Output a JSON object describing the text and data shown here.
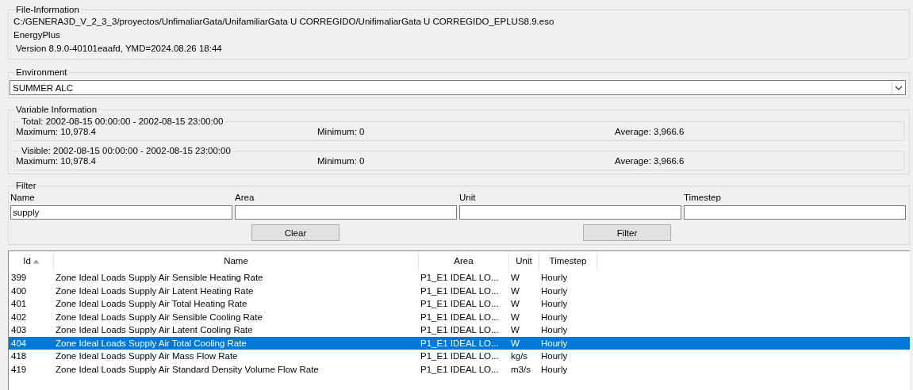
{
  "file_information": {
    "title": "File-Information",
    "path": "C:/GENERA3D_V_2_3_3/proyectos/UnfimaliarGata/UnifamiliarGata U CORREGIDO/UnifimaliarGata U CORREGIDO_EPLUS8.9.eso",
    "program": "EnergyPlus",
    "version": "Version 8.9.0-40101eaafd, YMD=2024.08.26 18:44"
  },
  "environment": {
    "title": "Environment",
    "value": "SUMMER ALC"
  },
  "variable_information": {
    "title": "Variable Information",
    "ranges": [
      {
        "title": "Total: 2002-08-15 00:00:00 - 2002-08-15 23:00:00",
        "maximum": "Maximum: 10,978.4",
        "minimum": "Minimum: 0",
        "average": "Average: 3,966.6"
      },
      {
        "title": "Visible: 2002-08-15 00:00:00 - 2002-08-15 23:00:00",
        "maximum": "Maximum: 10,978.4",
        "minimum": "Minimum: 0",
        "average": "Average: 3,966.6"
      }
    ]
  },
  "filter": {
    "title": "Filter",
    "fields": [
      {
        "label": "Name",
        "value": "supply"
      },
      {
        "label": "Area"
      },
      {
        "label": "Unit"
      },
      {
        "label": "Timestep"
      }
    ],
    "buttons": [
      "Clear",
      "Filter"
    ]
  },
  "table": {
    "columns": [
      {
        "label": "Id",
        "sorted": true
      },
      {
        "label": "Name",
        "sorted": false
      },
      {
        "label": "Area",
        "sorted": false
      },
      {
        "label": "Unit",
        "sorted": false
      },
      {
        "label": "Timestep",
        "sorted": false
      }
    ],
    "rows": [
      {
        "cells": [
          "399",
          "Zone Ideal Loads Supply Air Sensible Heating Rate",
          "P1_E1 IDEAL LO...",
          "W",
          "Hourly"
        ],
        "selected": false
      },
      {
        "cells": [
          "400",
          "Zone Ideal Loads Supply Air Latent Heating Rate",
          "P1_E1 IDEAL LO...",
          "W",
          "Hourly"
        ],
        "selected": false
      },
      {
        "cells": [
          "401",
          "Zone Ideal Loads Supply Air Total Heating Rate",
          "P1_E1 IDEAL LO...",
          "W",
          "Hourly"
        ],
        "selected": false
      },
      {
        "cells": [
          "402",
          "Zone Ideal Loads Supply Air Sensible Cooling Rate",
          "P1_E1 IDEAL LO...",
          "W",
          "Hourly"
        ],
        "selected": false
      },
      {
        "cells": [
          "403",
          "Zone Ideal Loads Supply Air Latent Cooling Rate",
          "P1_E1 IDEAL LO...",
          "W",
          "Hourly"
        ],
        "selected": false
      },
      {
        "cells": [
          "404",
          "Zone Ideal Loads Supply Air Total Cooling Rate",
          "P1_E1 IDEAL LO...",
          "W",
          "Hourly"
        ],
        "selected": true
      },
      {
        "cells": [
          "418",
          "Zone Ideal Loads Supply Air Mass Flow Rate",
          "P1_E1 IDEAL LO...",
          "kg/s",
          "Hourly"
        ],
        "selected": false
      },
      {
        "cells": [
          "419",
          "Zone Ideal Loads Supply Air Standard Density Volume Flow Rate",
          "P1_E1 IDEAL LO...",
          "m3/s",
          "Hourly"
        ],
        "selected": false
      }
    ]
  }
}
